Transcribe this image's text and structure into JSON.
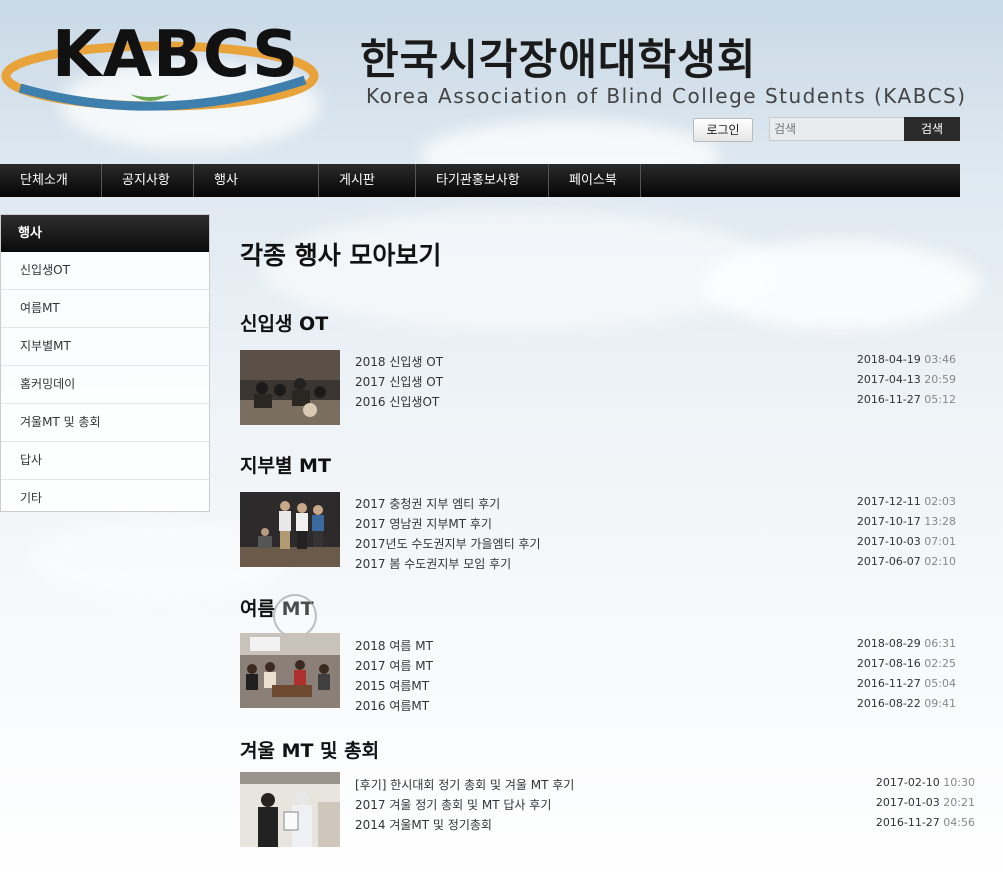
{
  "header": {
    "logo_text": "KABCS",
    "title_ko": "한국시각장애대학생회",
    "title_en": "Korea Association of Blind College Students (KABCS)",
    "login_label": "로그인",
    "search_placeholder": "검색",
    "search_button": "검색"
  },
  "nav": [
    {
      "label": "단체소개"
    },
    {
      "label": "공지사항"
    },
    {
      "label": "행사"
    },
    {
      "label": "게시판"
    },
    {
      "label": "타기관홍보사항"
    },
    {
      "label": "페이스북"
    }
  ],
  "sidebar": {
    "heading": "행사",
    "items": [
      {
        "label": "신입생OT"
      },
      {
        "label": "여름MT"
      },
      {
        "label": "지부별MT"
      },
      {
        "label": "홈커밍데이"
      },
      {
        "label": "겨울MT 및 총회"
      },
      {
        "label": "답사"
      },
      {
        "label": "기타"
      }
    ]
  },
  "main": {
    "title": "각종 행사 모아보기",
    "sections": [
      {
        "title": "신입생 OT",
        "posts": [
          {
            "title": "2018 신입생 OT",
            "date": "2018-04-19",
            "time": "03:46"
          },
          {
            "title": "2017 신입생 OT",
            "date": "2017-04-13",
            "time": "20:59"
          },
          {
            "title": "2016 신입생OT",
            "date": "2016-11-27",
            "time": "05:12"
          }
        ]
      },
      {
        "title": "지부별 MT",
        "posts": [
          {
            "title": "2017 충청권 지부 엠티 후기",
            "date": "2017-12-11",
            "time": "02:03"
          },
          {
            "title": "2017 영남권 지부MT 후기",
            "date": "2017-10-17",
            "time": "13:28"
          },
          {
            "title": "2017년도 수도권지부 가을엠티 후기",
            "date": "2017-10-03",
            "time": "07:01"
          },
          {
            "title": "2017 봄 수도권지부 모임 후기",
            "date": "2017-06-07",
            "time": "02:10"
          }
        ]
      },
      {
        "title": "여름 MT",
        "posts": [
          {
            "title": "2018 여름 MT",
            "date": "2018-08-29",
            "time": "06:31"
          },
          {
            "title": "2017 여름 MT",
            "date": "2017-08-16",
            "time": "02:25"
          },
          {
            "title": "2015 여름MT",
            "date": "2016-11-27",
            "time": "05:04"
          },
          {
            "title": "2016 여름MT",
            "date": "2016-08-22",
            "time": "09:41"
          }
        ]
      },
      {
        "title": "겨울 MT 및 총회",
        "posts": [
          {
            "title": "[후기] 한시대회 정기 총회 및 겨울 MT 후기",
            "date": "2017-02-10",
            "time": "10:30"
          },
          {
            "title": "2017 겨울 정기 총회 및 MT 답사 후기",
            "date": "2017-01-03",
            "time": "20:21"
          },
          {
            "title": "2014 겨울MT 및 정기총회",
            "date": "2016-11-27",
            "time": "04:56"
          }
        ]
      }
    ]
  },
  "colors": {
    "nav_bg": "#111111",
    "accent_time": "#888888",
    "logo_ring_orange": "#e8a33a",
    "logo_ring_blue": "#3f7fae"
  }
}
